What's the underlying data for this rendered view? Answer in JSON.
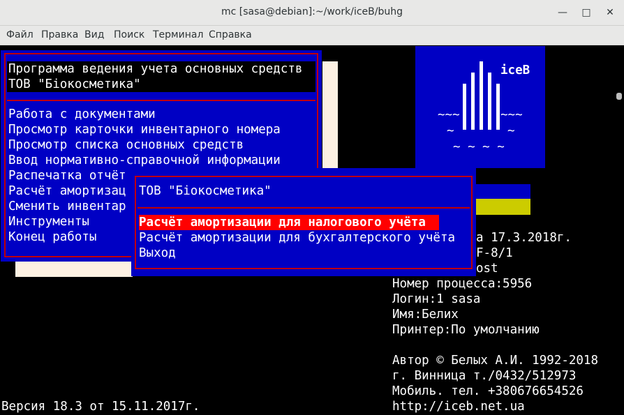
{
  "window": {
    "title": "mc [sasa@debian]:~/work/iceB/buhg",
    "minimize_icon": "minimize-icon",
    "maximize_icon": "maximize-icon",
    "close_icon": "close-icon"
  },
  "menubar": {
    "items": [
      "Файл",
      "Правка",
      "Вид",
      "Поиск",
      "Терминал",
      "Справка"
    ]
  },
  "main_menu": {
    "title_line1": "Программа ведения учета основных средств",
    "title_line2": "ТОВ \"Біокосметика\"",
    "items": [
      "Работа с документами",
      "Просмотр карточки инвентарного номера",
      "Просмотр списка основных средств",
      "Ввод нормативно-справочной информации",
      "Распечатка отчёт",
      "Расчёт амортизац",
      "Сменить инвентар",
      "Инструменты",
      "Конец работы"
    ]
  },
  "submenu": {
    "title": "ТОВ \"Біокосметика\"",
    "items": [
      "Расчёт амортизации для налогового учёта",
      "Расчёт амортизации для бухгалтерского учёта",
      "Выход"
    ],
    "selected_index": 0
  },
  "logo": {
    "name": "iceB",
    "wave1": "~~~",
    "wave2": "~~~",
    "wave3": "~",
    "wave4": "~",
    "wave5": "~ ~ ~ ~"
  },
  "info": {
    "date_fragment": "а 17.3.2018г.",
    "host_fragment1": "F-8/1",
    "host_fragment2": "ost",
    "process": "Номер процесса:5956",
    "login": "Логин:1 sasa",
    "name": "Имя:Белих",
    "printer": "Принтер:По умолчанию",
    "author": "Автор © Белых А.И. 1992-2018",
    "city_phone": "г. Винница т./0432/512973",
    "mobile": "Мобиль. тел. +380676654526",
    "url": "http://iceb.net.ua"
  },
  "footer": {
    "version": "Версия 18.3 от 15.11.2017г."
  },
  "colors": {
    "terminal_bg": "#000000",
    "window_bg": "#0000c4",
    "border": "#c00000",
    "highlight": "#ff0000",
    "flag_yellow": "#cccc00"
  }
}
